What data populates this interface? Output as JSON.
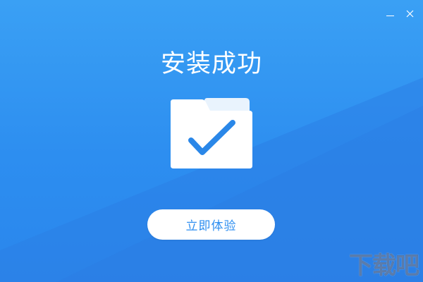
{
  "window": {
    "title": "安装成功",
    "controls": {
      "minimize_icon": "minimize-icon",
      "close_icon": "close-icon"
    }
  },
  "main": {
    "icon": "folder-check-icon",
    "primary_button_label": "立即体验"
  },
  "watermark": {
    "text": "下载吧"
  },
  "colors": {
    "background": "#2d8ef0",
    "background_light": "#3aa0f4",
    "accent": "#2a87e8",
    "text_on_bg": "#ffffff",
    "button_bg": "#ffffff"
  }
}
